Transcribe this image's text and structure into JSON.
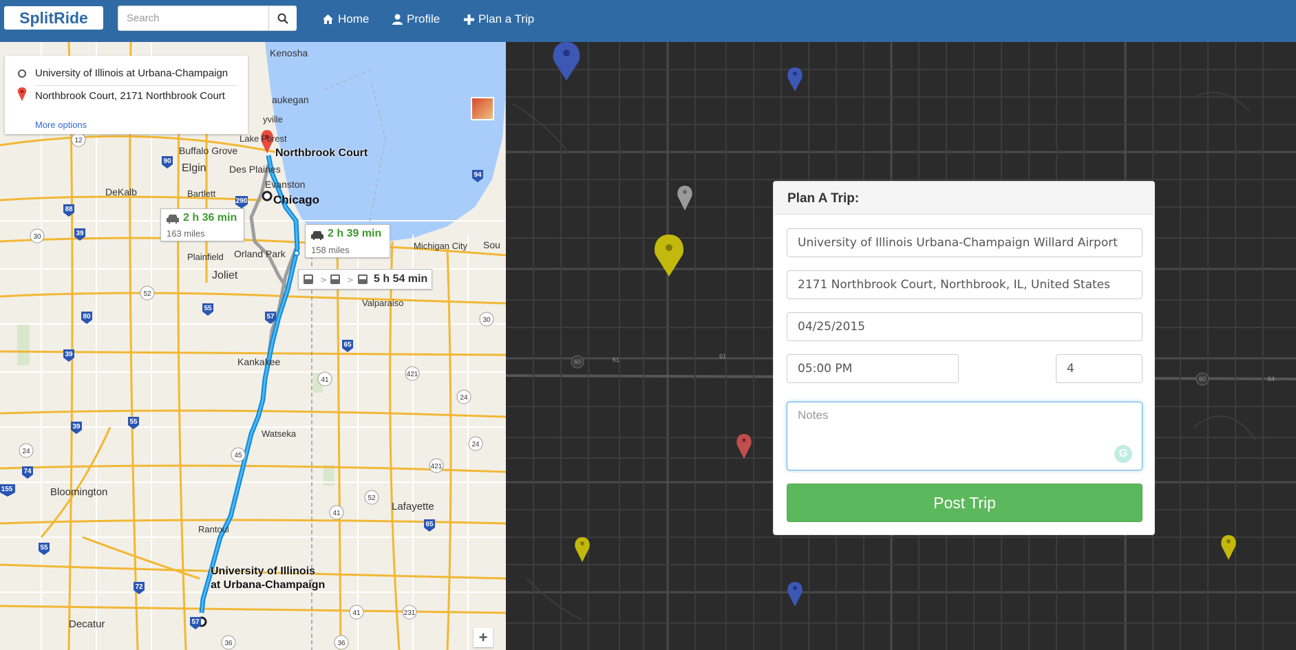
{
  "navbar": {
    "brand": "SplitRide",
    "search_placeholder": "Search",
    "links": [
      {
        "label": "Home",
        "icon": "home-icon"
      },
      {
        "label": "Profile",
        "icon": "user-icon"
      },
      {
        "label": "Plan a Trip",
        "icon": "plus-icon"
      }
    ]
  },
  "map_left": {
    "origin": "University of Illinois at Urbana-Champaign",
    "destination": "Northbrook Court, 2171 Northbrook Court",
    "more_options": "More options",
    "routes": [
      {
        "time": "2 h 36 min",
        "distance": "163 miles"
      },
      {
        "time": "2 h 39 min",
        "distance": "158 miles"
      },
      {
        "time": "5 h 54 min",
        "mode": "transit"
      }
    ],
    "places": {
      "destination_label": "Northbrook Court",
      "origin_label_1": "University of Illinois",
      "origin_label_2": "at Urbana-Champaign",
      "chicago": "Chicago",
      "kenosha": "Kenosha",
      "waukegan": "aukegan",
      "buffalo_grove": "Buffalo Grove",
      "elgin": "Elgin",
      "des_plaines": "Des Plaines",
      "evanston": "Evanston",
      "dekalb": "DeKalb",
      "bartlett": "Bartlett",
      "plainfield": "Plainfield",
      "orland_park": "Orland Park",
      "joliet": "Joliet",
      "michigan_city": "Michigan City",
      "valparaiso": "Valparaiso",
      "kankakee": "Kankakee",
      "watseka": "Watseka",
      "bloomington": "Bloomington",
      "lafayette": "Lafayette",
      "rantoul": "Rantoul",
      "decatur": "Decatur",
      "lake_forest": "Lake Forest",
      "libertyville": "yville",
      "south": "Sou"
    }
  },
  "form": {
    "title": "Plan A Trip:",
    "from": "University of Illinois Urbana-Champaign Willard Airport",
    "to": "2171 Northbrook Court, Northbrook, IL, United States",
    "date": "04/25/2015",
    "time": "05:00 PM",
    "seats": "4",
    "notes_placeholder": "Notes",
    "submit": "Post Trip"
  },
  "colors": {
    "navbar": "#2f6aa5",
    "post_button": "#5cb85c",
    "route_primary": "#1a9ae0",
    "route_alt": "#9e9e9e",
    "pin_blue": "#3d57b5",
    "pin_yellow": "#c2b90c",
    "pin_red": "#c0504d",
    "pin_gray": "#9a9a9a"
  }
}
